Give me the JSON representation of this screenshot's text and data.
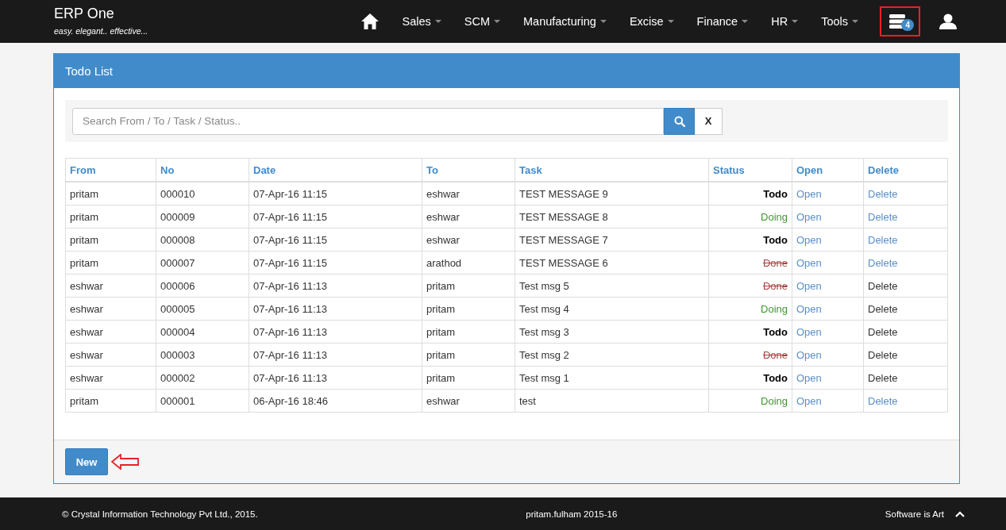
{
  "brand": {
    "title": "ERP One",
    "tagline": "easy. elegant.. effective..."
  },
  "nav": [
    {
      "label": "Sales"
    },
    {
      "label": "SCM"
    },
    {
      "label": "Manufacturing"
    },
    {
      "label": "Excise"
    },
    {
      "label": "Finance"
    },
    {
      "label": "HR"
    },
    {
      "label": "Tools"
    }
  ],
  "notifications": {
    "count": "4"
  },
  "panel": {
    "title": "Todo List"
  },
  "search": {
    "placeholder": "Search From / To / Task / Status..",
    "clear_label": "X"
  },
  "table": {
    "columns": [
      "From",
      "No",
      "Date",
      "To",
      "Task",
      "Status",
      "Open",
      "Delete"
    ],
    "rows": [
      {
        "from": "pritam",
        "no": "000010",
        "date": "07-Apr-16 11:15",
        "to": "eshwar",
        "task": "TEST MESSAGE 9",
        "status": {
          "label": "Todo",
          "kind": "todo"
        },
        "open": "Open",
        "delete": "Delete",
        "delete_disabled": false
      },
      {
        "from": "pritam",
        "no": "000009",
        "date": "07-Apr-16 11:15",
        "to": "eshwar",
        "task": "TEST MESSAGE 8",
        "status": {
          "label": "Doing",
          "kind": "doing"
        },
        "open": "Open",
        "delete": "Delete",
        "delete_disabled": false
      },
      {
        "from": "pritam",
        "no": "000008",
        "date": "07-Apr-16 11:15",
        "to": "eshwar",
        "task": "TEST MESSAGE 7",
        "status": {
          "label": "Todo",
          "kind": "todo"
        },
        "open": "Open",
        "delete": "Delete",
        "delete_disabled": false
      },
      {
        "from": "pritam",
        "no": "000007",
        "date": "07-Apr-16 11:15",
        "to": "arathod",
        "task": "TEST MESSAGE 6",
        "status": {
          "label": "Done",
          "kind": "done"
        },
        "open": "Open",
        "delete": "Delete",
        "delete_disabled": false
      },
      {
        "from": "eshwar",
        "no": "000006",
        "date": "07-Apr-16 11:13",
        "to": "pritam",
        "task": "Test msg 5",
        "status": {
          "label": "Done",
          "kind": "done"
        },
        "open": "Open",
        "delete": "Delete",
        "delete_disabled": true
      },
      {
        "from": "eshwar",
        "no": "000005",
        "date": "07-Apr-16 11:13",
        "to": "pritam",
        "task": "Test msg 4",
        "status": {
          "label": "Doing",
          "kind": "doing"
        },
        "open": "Open",
        "delete": "Delete",
        "delete_disabled": true
      },
      {
        "from": "eshwar",
        "no": "000004",
        "date": "07-Apr-16 11:13",
        "to": "pritam",
        "task": "Test msg 3",
        "status": {
          "label": "Todo",
          "kind": "todo"
        },
        "open": "Open",
        "delete": "Delete",
        "delete_disabled": true
      },
      {
        "from": "eshwar",
        "no": "000003",
        "date": "07-Apr-16 11:13",
        "to": "pritam",
        "task": "Test msg 2",
        "status": {
          "label": "Done",
          "kind": "done"
        },
        "open": "Open",
        "delete": "Delete",
        "delete_disabled": true
      },
      {
        "from": "eshwar",
        "no": "000002",
        "date": "07-Apr-16 11:13",
        "to": "pritam",
        "task": "Test msg 1",
        "status": {
          "label": "Todo",
          "kind": "todo"
        },
        "open": "Open",
        "delete": "Delete",
        "delete_disabled": true
      },
      {
        "from": "pritam",
        "no": "000001",
        "date": "06-Apr-16 18:46",
        "to": "eshwar",
        "task": "test",
        "status": {
          "label": "Doing",
          "kind": "doing"
        },
        "open": "Open",
        "delete": "Delete",
        "delete_disabled": false
      }
    ]
  },
  "new_button": "New",
  "footer": {
    "copyright": "© Crystal Information Technology Pvt Ltd., 2015.",
    "user": "pritam.fulham 2015-16",
    "slogan": "Software is Art"
  }
}
